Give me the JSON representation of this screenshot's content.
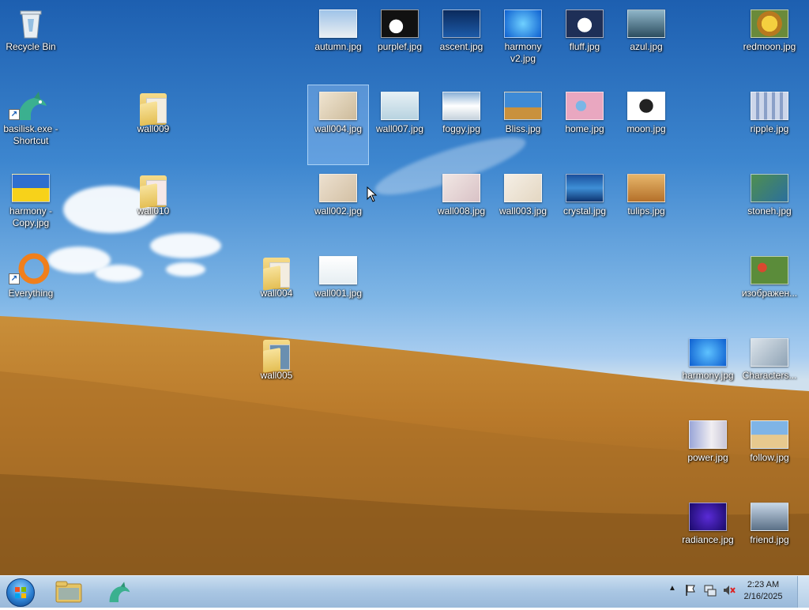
{
  "desktop": {
    "icons": [
      {
        "label": "Recycle Bin"
      },
      {
        "label": "basilisk.exe - Shortcut"
      },
      {
        "label": "harmony - Copy.jpg"
      },
      {
        "label": "Everything"
      },
      {
        "label": "wall009"
      },
      {
        "label": "wall010"
      },
      {
        "label": "wall004"
      },
      {
        "label": "wall005"
      },
      {
        "label": "autumn.jpg"
      },
      {
        "label": "purplef.jpg"
      },
      {
        "label": "ascent.jpg"
      },
      {
        "label": "harmony v2.jpg"
      },
      {
        "label": "fluff.jpg"
      },
      {
        "label": "azul.jpg"
      },
      {
        "label": "redmoon.jpg"
      },
      {
        "label": "wall004.jpg"
      },
      {
        "label": "wall007.jpg"
      },
      {
        "label": "foggy.jpg"
      },
      {
        "label": "Bliss.jpg"
      },
      {
        "label": "home.jpg"
      },
      {
        "label": "moon.jpg"
      },
      {
        "label": "ripple.jpg"
      },
      {
        "label": "wall002.jpg"
      },
      {
        "label": "wall008.jpg"
      },
      {
        "label": "wall003.jpg"
      },
      {
        "label": "crystal.jpg"
      },
      {
        "label": "tulips.jpg"
      },
      {
        "label": "stoneh.jpg"
      },
      {
        "label": "wall001.jpg"
      },
      {
        "label": "изображен..."
      },
      {
        "label": "harmony.jpg"
      },
      {
        "label": "Characters..."
      },
      {
        "label": "power.jpg"
      },
      {
        "label": "follow.jpg"
      },
      {
        "label": "radiance.jpg"
      },
      {
        "label": "friend.jpg"
      }
    ]
  },
  "taskbar": {
    "clock": {
      "time": "2:23 AM",
      "date": "2/16/2025"
    },
    "tray_icons": [
      "chevron-up-icon",
      "flag-icon",
      "network-icon",
      "volume-muted-icon"
    ]
  }
}
